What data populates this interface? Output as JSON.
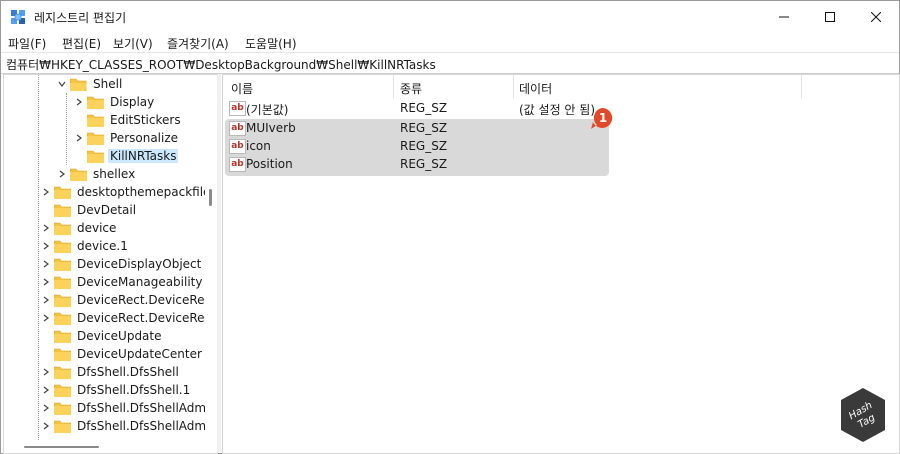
{
  "window": {
    "title": "레지스트리 편집기"
  },
  "menu": [
    "파일(F)",
    "편집(E)",
    "보기(V)",
    "즐겨찾기(A)",
    "도움말(H)"
  ],
  "address": "컴퓨터₩HKEY_CLASSES_ROOT₩DesktopBackground₩Shell₩KillNRTasks",
  "tree": {
    "shell_node": "Shell",
    "shell_children": [
      "Display",
      "EditStickers",
      "Personalize",
      "KillNRTasks"
    ],
    "selected": "KillNRTasks",
    "shellex": "shellex",
    "root_items": [
      "desktopthemepackfile",
      "DevDetail",
      "device",
      "device.1",
      "DeviceDisplayObject",
      "DeviceManageability",
      "DeviceRect.DeviceRect",
      "DeviceRect.DeviceRect.",
      "DeviceUpdate",
      "DeviceUpdateCenter",
      "DfsShell.DfsShell",
      "DfsShell.DfsShell.1",
      "DfsShell.DfsShellAdmir",
      "DfsShell.DfsShellAdmir"
    ]
  },
  "list": {
    "columns": [
      "이름",
      "종류",
      "데이터"
    ],
    "rows": [
      {
        "name": "(기본값)",
        "type": "REG_SZ",
        "data": "(값 설정 안 됨)"
      },
      {
        "name": "MUIverb",
        "type": "REG_SZ",
        "data": ""
      },
      {
        "name": "icon",
        "type": "REG_SZ",
        "data": ""
      },
      {
        "name": "Position",
        "type": "REG_SZ",
        "data": ""
      }
    ]
  },
  "badge": "1",
  "logo": {
    "line1": "Hash",
    "line2": "Tag"
  },
  "colors": {
    "accent": "#e04a2a",
    "selection": "#cce8ff",
    "folder": "#f6c443",
    "highlight": "#d9d9d9"
  }
}
